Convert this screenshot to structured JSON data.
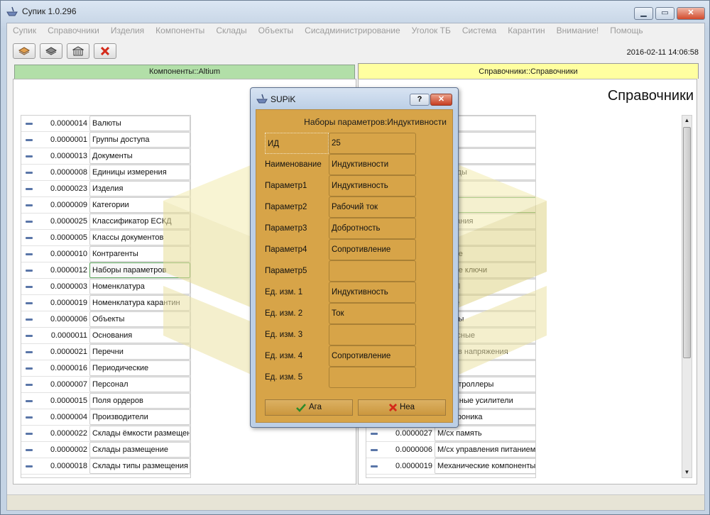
{
  "window": {
    "title": "Супик 1.0.296",
    "minimize": "▁",
    "maximize": "▭",
    "close": "✕"
  },
  "menu": [
    "Супик",
    "Справочники",
    "Изделия",
    "Компоненты",
    "Склады",
    "Объекты",
    "Сисадминистрирование",
    "Уголок ТБ",
    "Система",
    "Карантин",
    "Внимание!",
    "Помощь"
  ],
  "toolbar": {
    "icons": [
      "books-icon",
      "book-gray-icon",
      "building-icon",
      "red-x-icon"
    ],
    "datetime": "2016-02-11 14:06:58"
  },
  "tabs": {
    "left": "Компоненты::Altium",
    "right": "Справочники::Справочники"
  },
  "right_pane": {
    "heading": "Справочники"
  },
  "left_list": [
    {
      "num": "0.0000014",
      "name": "Валюты"
    },
    {
      "num": "0.0000001",
      "name": "Группы доступа"
    },
    {
      "num": "0.0000013",
      "name": "Документы"
    },
    {
      "num": "0.0000008",
      "name": "Единицы измерения"
    },
    {
      "num": "0.0000023",
      "name": "Изделия"
    },
    {
      "num": "0.0000009",
      "name": "Категории"
    },
    {
      "num": "0.0000025",
      "name": "Классификатор ЕСКД"
    },
    {
      "num": "0.0000005",
      "name": "Классы документов"
    },
    {
      "num": "0.0000010",
      "name": "Контрагенты"
    },
    {
      "num": "0.0000012",
      "name": "Наборы параметров"
    },
    {
      "num": "0.0000003",
      "name": "Номенклатура"
    },
    {
      "num": "0.0000019",
      "name": "Номенклатура карантин"
    },
    {
      "num": "0.0000006",
      "name": "Объекты"
    },
    {
      "num": "0.0000011",
      "name": "Основания"
    },
    {
      "num": "0.0000021",
      "name": "Перечни"
    },
    {
      "num": "0.0000016",
      "name": "Периодические"
    },
    {
      "num": "0.0000007",
      "name": "Персонал"
    },
    {
      "num": "0.0000015",
      "name": "Поля ордеров"
    },
    {
      "num": "0.0000004",
      "name": "Производители"
    },
    {
      "num": "0.0000022",
      "name": "Склады ёмкости размещения"
    },
    {
      "num": "0.0000002",
      "name": "Склады размещение"
    },
    {
      "num": "0.0000018",
      "name": "Склады типы размещения"
    }
  ],
  "right_list": [
    {
      "num": "",
      "name": "ы"
    },
    {
      "num": "",
      "name": "ры"
    },
    {
      "num": "",
      "name": ""
    },
    {
      "num": "",
      "name": "е диоды"
    },
    {
      "num": "",
      "name": "ы"
    },
    {
      "num": "",
      "name": "ности"
    },
    {
      "num": "",
      "name": "и питания"
    },
    {
      "num": "",
      "name": "торы"
    },
    {
      "num": "",
      "name": "оговые"
    },
    {
      "num": "",
      "name": "оговые ключи"
    },
    {
      "num": "",
      "name": "и ЦАП"
    },
    {
      "num": "",
      "name": "итные"
    },
    {
      "num": "",
      "name": "ляторы"
    },
    {
      "num": "",
      "name": "рфейсные"
    },
    {
      "num": "",
      "name": "чников напряжения"
    },
    {
      "num": "",
      "name": "ка"
    },
    {
      "num": "",
      "name": "роконтроллеры"
    },
    {
      "num": "",
      "name": "ационные усилители"
    },
    {
      "num": "",
      "name": "электроника"
    },
    {
      "num": "0.0000027",
      "name": "М/сх память"
    },
    {
      "num": "0.0000006",
      "name": "М/сх управления питанием"
    },
    {
      "num": "0.0000019",
      "name": "Механические компоненты"
    }
  ],
  "dialog": {
    "title": "SUPiK",
    "help": "?",
    "close": "✕",
    "heading": "Наборы параметров:Индуктивности",
    "fields": [
      {
        "label": "ИД",
        "value": "25"
      },
      {
        "label": "Наименование",
        "value": "Индуктивности"
      },
      {
        "label": "Параметр1",
        "value": "Индуктивность"
      },
      {
        "label": "Параметр2",
        "value": "Рабочий ток"
      },
      {
        "label": "Параметр3",
        "value": "Добротность"
      },
      {
        "label": "Параметр4",
        "value": "Сопротивление"
      },
      {
        "label": "Параметр5",
        "value": ""
      },
      {
        "label": "Ед. изм. 1",
        "value": "Индуктивность"
      },
      {
        "label": "Ед. изм. 2",
        "value": "Ток"
      },
      {
        "label": "Ед. изм. 3",
        "value": ""
      },
      {
        "label": "Ед. изм. 4",
        "value": "Сопротивление"
      },
      {
        "label": "Ед. изм. 5",
        "value": ""
      }
    ],
    "ok_label": "Ага",
    "cancel_label": "Неа"
  }
}
